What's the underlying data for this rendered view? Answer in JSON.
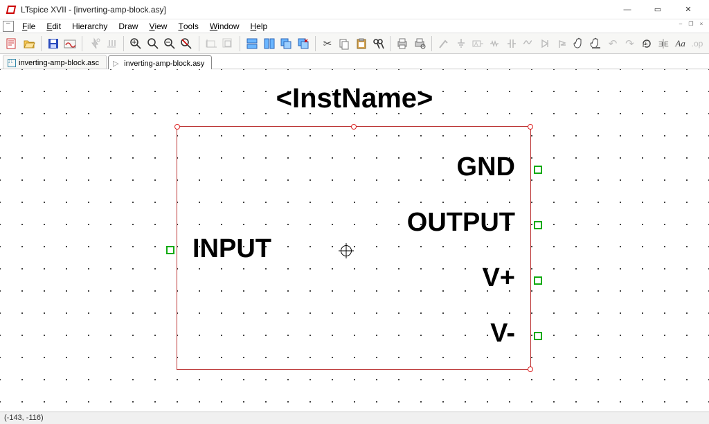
{
  "window": {
    "title": "LTspice XVII - [inverting-amp-block.asy]"
  },
  "menu": {
    "items": [
      "File",
      "Edit",
      "Hierarchy",
      "Draw",
      "View",
      "Tools",
      "Window",
      "Help"
    ]
  },
  "tabs": [
    {
      "label": "inverting-amp-block.asc",
      "kind": "asc",
      "active": false
    },
    {
      "label": "inverting-amp-block.asy",
      "kind": "asy",
      "active": true
    }
  ],
  "symbol": {
    "inst_name_label": "<InstName>",
    "pins": {
      "input": {
        "label": "INPUT"
      },
      "gnd": {
        "label": "GND"
      },
      "output": {
        "label": "OUTPUT"
      },
      "vpos": {
        "label": "V+"
      },
      "vneg": {
        "label": "V-"
      }
    }
  },
  "status": {
    "coords": "(-143, -116)"
  },
  "glyphs": {
    "minimize": "—",
    "maximize": "▭",
    "close": "✕"
  }
}
